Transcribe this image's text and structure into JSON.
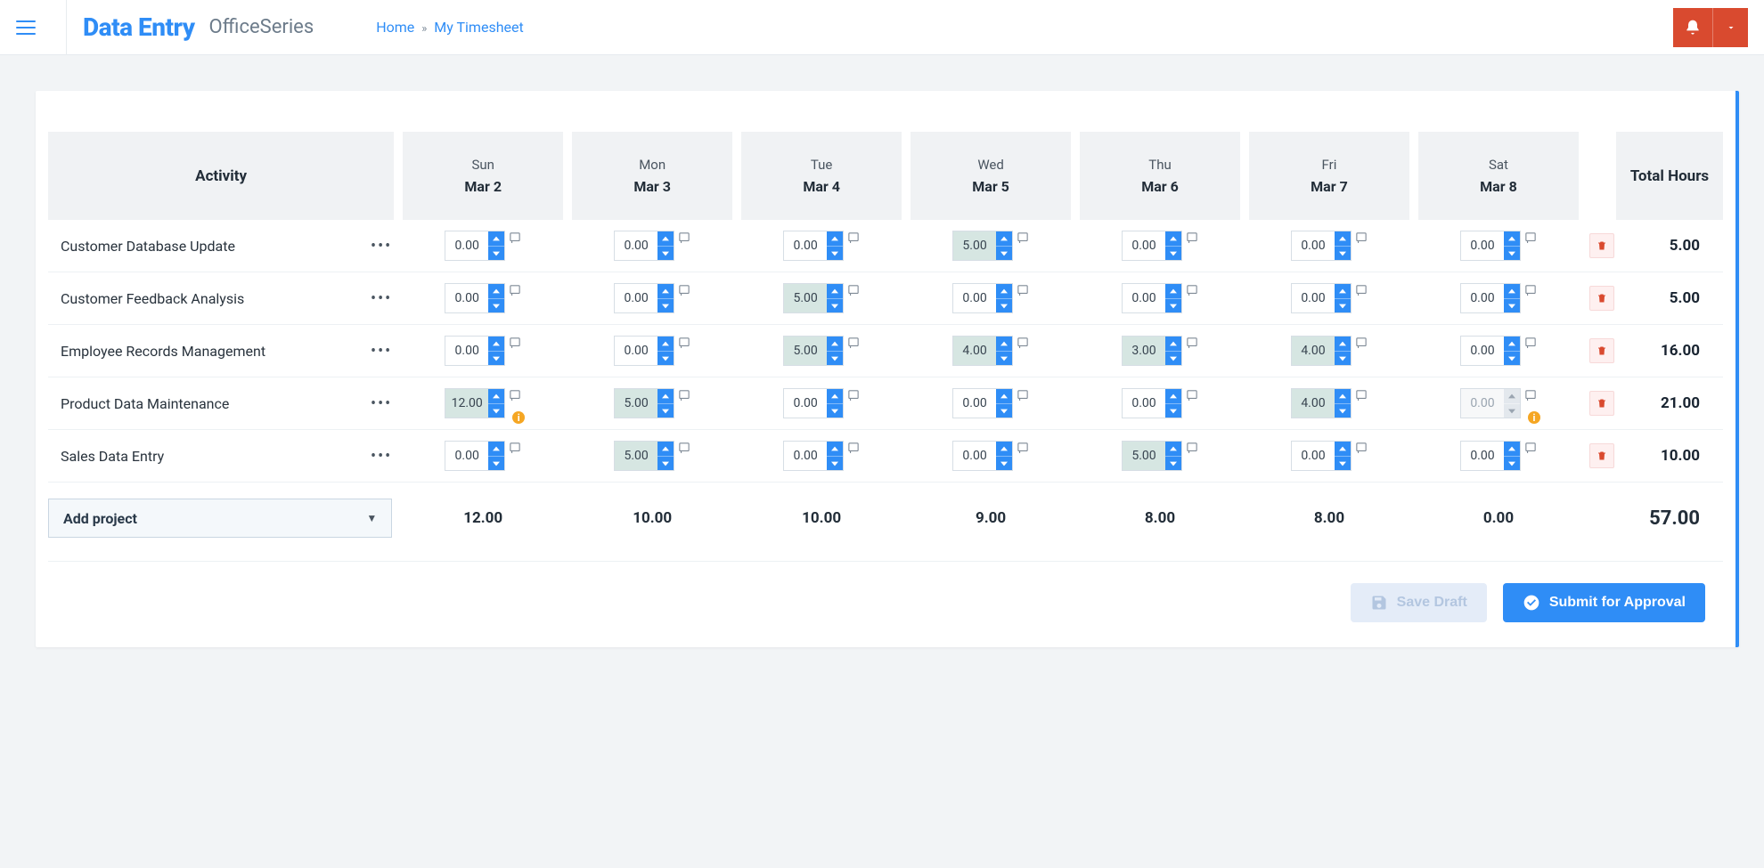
{
  "header": {
    "brand": "Data Entry",
    "brand_suffix": "OfficeSeries",
    "breadcrumb_home": "Home",
    "breadcrumb_sep": "»",
    "breadcrumb_current": "My Timesheet"
  },
  "table": {
    "activity_header": "Activity",
    "total_header": "Total Hours",
    "days": [
      {
        "dow": "Sun",
        "date": "Mar 2"
      },
      {
        "dow": "Mon",
        "date": "Mar 3"
      },
      {
        "dow": "Tue",
        "date": "Mar 4"
      },
      {
        "dow": "Wed",
        "date": "Mar 5"
      },
      {
        "dow": "Thu",
        "date": "Mar 6"
      },
      {
        "dow": "Fri",
        "date": "Mar 7"
      },
      {
        "dow": "Sat",
        "date": "Mar 8"
      }
    ],
    "rows": [
      {
        "activity": "Customer Database Update",
        "cells": [
          {
            "val": "0.00",
            "filled": false,
            "disabled": false,
            "warn": false
          },
          {
            "val": "0.00",
            "filled": false,
            "disabled": false,
            "warn": false
          },
          {
            "val": "0.00",
            "filled": false,
            "disabled": false,
            "warn": false
          },
          {
            "val": "5.00",
            "filled": true,
            "disabled": false,
            "warn": false
          },
          {
            "val": "0.00",
            "filled": false,
            "disabled": false,
            "warn": false
          },
          {
            "val": "0.00",
            "filled": false,
            "disabled": false,
            "warn": false
          },
          {
            "val": "0.00",
            "filled": false,
            "disabled": false,
            "warn": false
          }
        ],
        "total": "5.00"
      },
      {
        "activity": "Customer Feedback Analysis",
        "cells": [
          {
            "val": "0.00",
            "filled": false,
            "disabled": false,
            "warn": false
          },
          {
            "val": "0.00",
            "filled": false,
            "disabled": false,
            "warn": false
          },
          {
            "val": "5.00",
            "filled": true,
            "disabled": false,
            "warn": false
          },
          {
            "val": "0.00",
            "filled": false,
            "disabled": false,
            "warn": false
          },
          {
            "val": "0.00",
            "filled": false,
            "disabled": false,
            "warn": false
          },
          {
            "val": "0.00",
            "filled": false,
            "disabled": false,
            "warn": false
          },
          {
            "val": "0.00",
            "filled": false,
            "disabled": false,
            "warn": false
          }
        ],
        "total": "5.00"
      },
      {
        "activity": "Employee Records Management",
        "cells": [
          {
            "val": "0.00",
            "filled": false,
            "disabled": false,
            "warn": false
          },
          {
            "val": "0.00",
            "filled": false,
            "disabled": false,
            "warn": false
          },
          {
            "val": "5.00",
            "filled": true,
            "disabled": false,
            "warn": false
          },
          {
            "val": "4.00",
            "filled": true,
            "disabled": false,
            "warn": false
          },
          {
            "val": "3.00",
            "filled": true,
            "disabled": false,
            "warn": false
          },
          {
            "val": "4.00",
            "filled": true,
            "disabled": false,
            "warn": false
          },
          {
            "val": "0.00",
            "filled": false,
            "disabled": false,
            "warn": false
          }
        ],
        "total": "16.00"
      },
      {
        "activity": "Product Data Maintenance",
        "cells": [
          {
            "val": "12.00",
            "filled": true,
            "disabled": false,
            "warn": true
          },
          {
            "val": "5.00",
            "filled": true,
            "disabled": false,
            "warn": false
          },
          {
            "val": "0.00",
            "filled": false,
            "disabled": false,
            "warn": false
          },
          {
            "val": "0.00",
            "filled": false,
            "disabled": false,
            "warn": false
          },
          {
            "val": "0.00",
            "filled": false,
            "disabled": false,
            "warn": false
          },
          {
            "val": "4.00",
            "filled": true,
            "disabled": false,
            "warn": false
          },
          {
            "val": "0.00",
            "filled": false,
            "disabled": true,
            "warn": true
          }
        ],
        "total": "21.00"
      },
      {
        "activity": "Sales Data Entry",
        "cells": [
          {
            "val": "0.00",
            "filled": false,
            "disabled": false,
            "warn": false
          },
          {
            "val": "5.00",
            "filled": true,
            "disabled": false,
            "warn": false
          },
          {
            "val": "0.00",
            "filled": false,
            "disabled": false,
            "warn": false
          },
          {
            "val": "0.00",
            "filled": false,
            "disabled": false,
            "warn": false
          },
          {
            "val": "5.00",
            "filled": true,
            "disabled": false,
            "warn": false
          },
          {
            "val": "0.00",
            "filled": false,
            "disabled": false,
            "warn": false
          },
          {
            "val": "0.00",
            "filled": false,
            "disabled": false,
            "warn": false
          }
        ],
        "total": "10.00"
      }
    ],
    "col_totals": [
      "12.00",
      "10.00",
      "10.00",
      "9.00",
      "8.00",
      "8.00",
      "0.00"
    ],
    "grand_total": "57.00",
    "add_project_label": "Add project"
  },
  "actions": {
    "save_draft": "Save Draft",
    "submit": "Submit for Approval"
  }
}
